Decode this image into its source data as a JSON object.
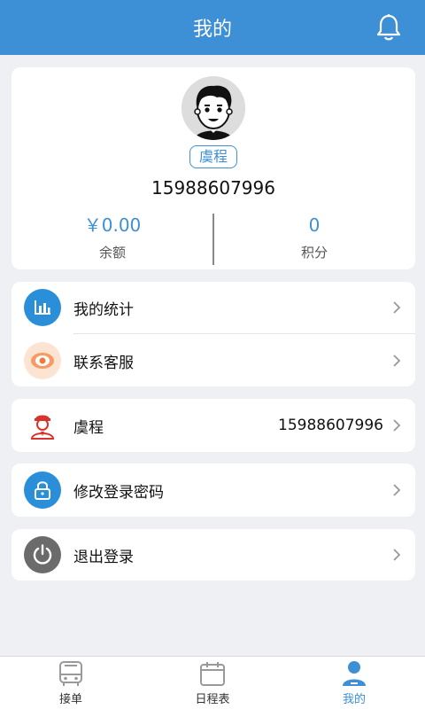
{
  "header": {
    "title": "我的",
    "bell_icon": "bell-icon"
  },
  "profile": {
    "name": "虞程",
    "phone": "15988607996",
    "balance_value": "￥0.00",
    "balance_label": "余额",
    "points_value": "0",
    "points_label": "积分"
  },
  "menu1": {
    "stats_label": "我的统计",
    "service_label": "联系客服"
  },
  "user_row": {
    "name": "虞程",
    "phone": "15988607996"
  },
  "password_row": {
    "label": "修改登录密码"
  },
  "logout_row": {
    "label": "退出登录"
  },
  "tabs": [
    {
      "label": "接单",
      "icon": "bus-icon"
    },
    {
      "label": "日程表",
      "icon": "calendar-icon"
    },
    {
      "label": "我的",
      "icon": "user-icon"
    }
  ],
  "colors": {
    "accent": "#3d8fd6",
    "background": "#eef0f4",
    "service": "#f07a3a",
    "user": "#d9342b",
    "logout": "#666666"
  }
}
